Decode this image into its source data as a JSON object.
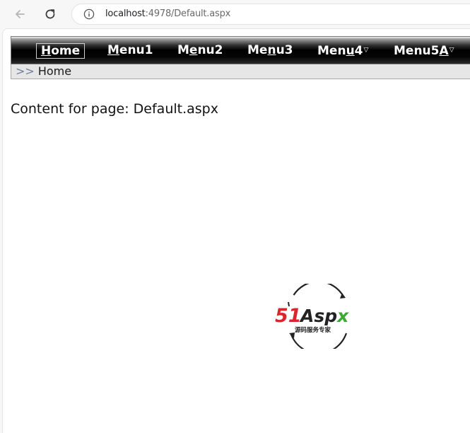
{
  "browser": {
    "url_host": "localhost",
    "url_rest": ":4978/Default.aspx"
  },
  "menu": {
    "items": [
      {
        "pre": "",
        "ul": "H",
        "post": "ome",
        "caret": ""
      },
      {
        "pre": "",
        "ul": "M",
        "post": "enu1",
        "caret": ""
      },
      {
        "pre": "M",
        "ul": "e",
        "post": "nu2",
        "caret": ""
      },
      {
        "pre": "Me",
        "ul": "n",
        "post": "u3",
        "caret": ""
      },
      {
        "pre": "Men",
        "ul": "u",
        "post": "4",
        "caret": "▽"
      },
      {
        "pre": "Menu5",
        "ul": "A",
        "post": "",
        "caret": "▽"
      }
    ]
  },
  "breadcrumb": {
    "separator": ">>",
    "current": "Home"
  },
  "content": {
    "text": "Content for page: Default.aspx"
  },
  "logo": {
    "brand_51": "51",
    "brand_aspx": "Aspx",
    "tagline": "源码服务专家",
    "colors": {
      "red": "#d7262c",
      "green": "#3aa935",
      "dark": "#222222"
    }
  }
}
